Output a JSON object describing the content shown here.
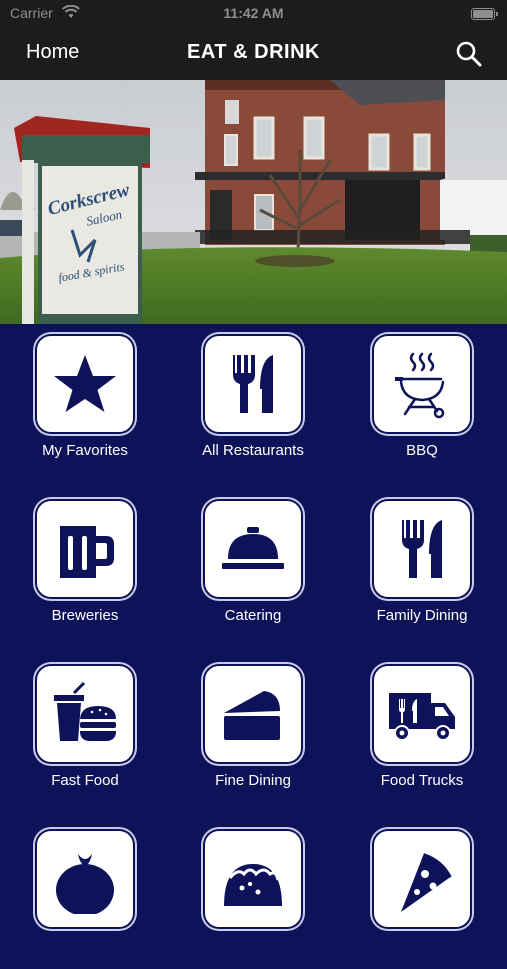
{
  "status": {
    "carrier": "Carrier",
    "time": "11:42 AM"
  },
  "nav": {
    "home_label": "Home",
    "title": "EAT & DRINK"
  },
  "hero": {
    "sign_line1": "Corkscrew",
    "sign_line2": "Saloon",
    "sign_line3": "food & spirits"
  },
  "colors": {
    "background": "#0d1259",
    "icon": "#0d1259",
    "bar": "#1c1c1c"
  },
  "categories": [
    {
      "label": "My Favorites",
      "icon": "star-icon"
    },
    {
      "label": "All Restaurants",
      "icon": "fork-knife-icon"
    },
    {
      "label": "BBQ",
      "icon": "grill-icon"
    },
    {
      "label": "Breweries",
      "icon": "beer-mug-icon"
    },
    {
      "label": "Catering",
      "icon": "cloche-icon"
    },
    {
      "label": "Family Dining",
      "icon": "fork-knife-icon"
    },
    {
      "label": "Fast Food",
      "icon": "drink-burger-icon"
    },
    {
      "label": "Fine Dining",
      "icon": "cake-slice-icon"
    },
    {
      "label": "Food Trucks",
      "icon": "food-truck-icon"
    },
    {
      "label": "",
      "icon": "tomato-icon"
    },
    {
      "label": "",
      "icon": "taco-icon"
    },
    {
      "label": "",
      "icon": "pizza-icon"
    }
  ]
}
